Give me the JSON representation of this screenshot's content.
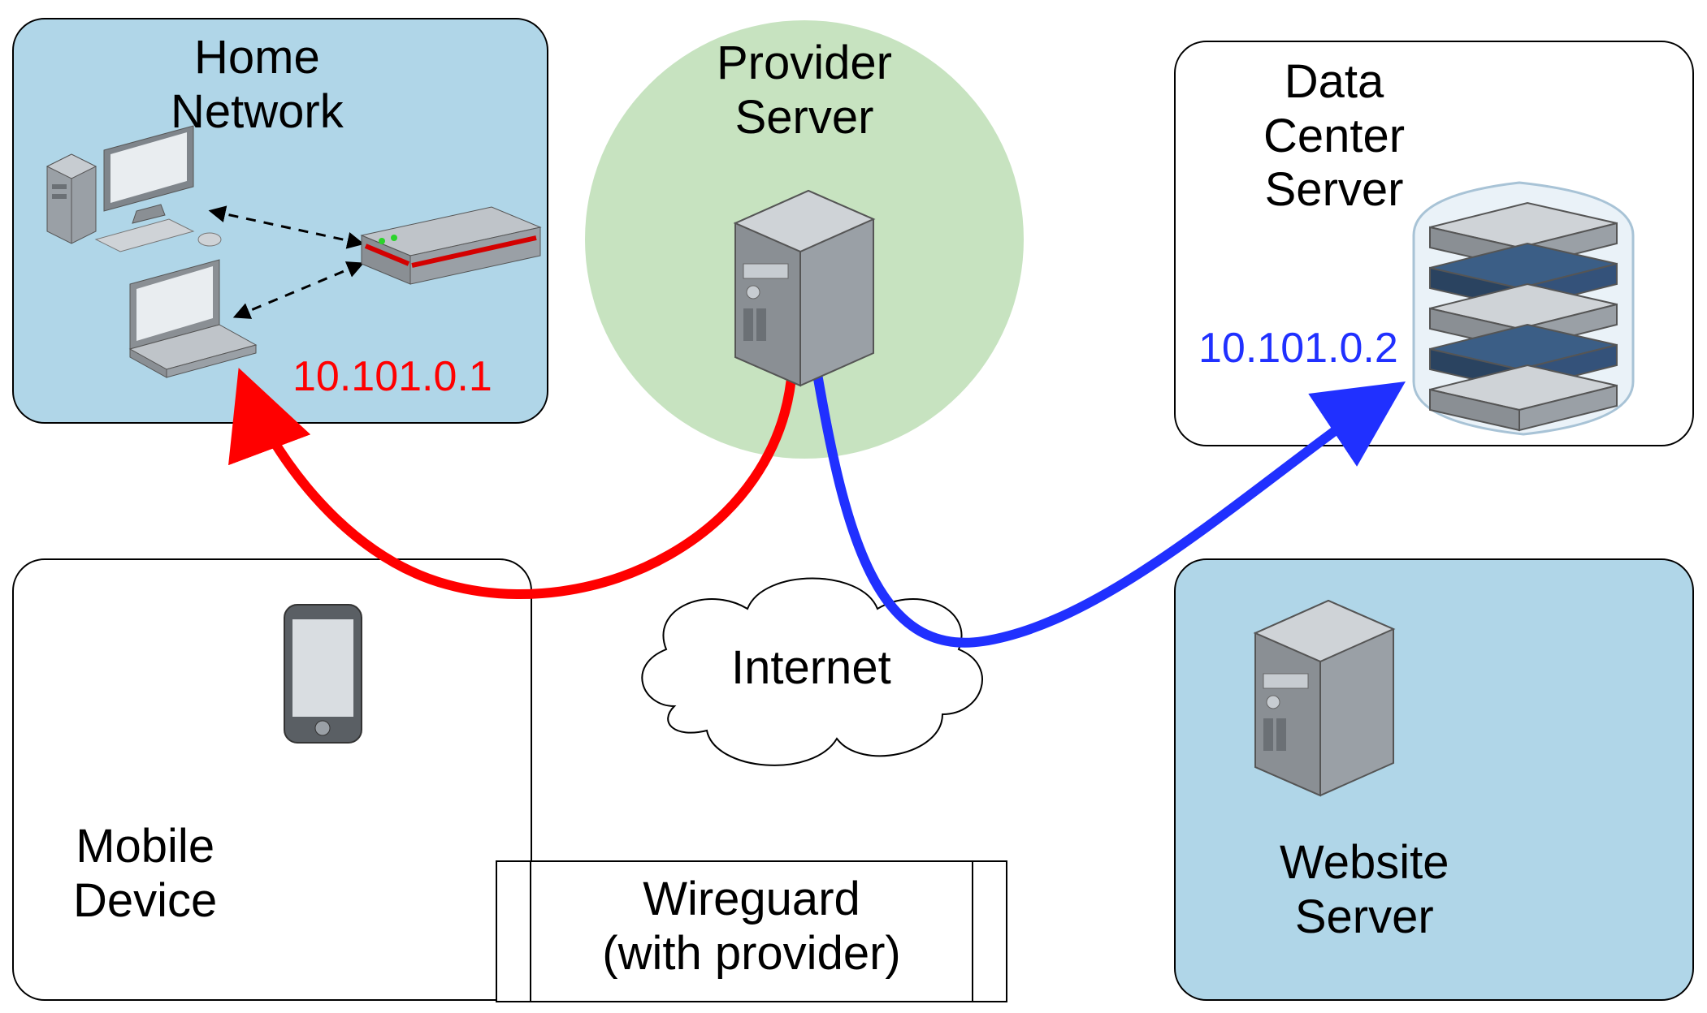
{
  "labels": {
    "home_network": "Home\nNetwork",
    "provider_server": "Provider\nServer",
    "data_center_server": "Data\nCenter\nServer",
    "mobile_device": "Mobile\nDevice",
    "website_server": "Website\nServer",
    "internet": "Internet",
    "caption": "Wireguard\n(with provider)"
  },
  "ips": {
    "home": "10.101.0.1",
    "dc": "10.101.0.2"
  },
  "colors": {
    "blue_box": "#b0d6e8",
    "circle": "#c7e3c0",
    "red": "#ff0000",
    "blue": "#2030ff"
  }
}
